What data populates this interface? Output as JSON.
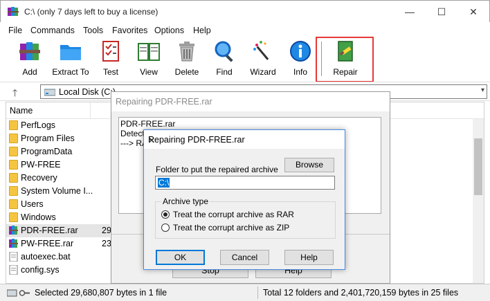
{
  "window": {
    "title": "C:\\ (only 7 days left to buy a license)",
    "minimize": "—",
    "maximize": "☐",
    "close": "✕"
  },
  "menu": [
    "File",
    "Commands",
    "Tools",
    "Favorites",
    "Options",
    "Help"
  ],
  "toolbar": {
    "buttons": [
      {
        "label": "Add",
        "icon": "archive-books-icon"
      },
      {
        "label": "Extract To",
        "icon": "folder-icon"
      },
      {
        "label": "Test",
        "icon": "checklist-icon"
      },
      {
        "label": "View",
        "icon": "open-book-icon"
      },
      {
        "label": "Delete",
        "icon": "trash-icon"
      },
      {
        "label": "Find",
        "icon": "magnifier-icon"
      },
      {
        "label": "Wizard",
        "icon": "wand-icon"
      },
      {
        "label": "Info",
        "icon": "info-icon"
      },
      {
        "label": "Repair",
        "icon": "repair-kit-icon"
      }
    ]
  },
  "address": {
    "up": "🡑",
    "value": "Local Disk (C:)",
    "dropdown": "▾"
  },
  "filelist": {
    "column_name": "Name",
    "rows": [
      {
        "name": "PerfLogs",
        "size": "",
        "type": "folder"
      },
      {
        "name": "Program Files",
        "size": "",
        "type": "folder"
      },
      {
        "name": "ProgramData",
        "size": "",
        "type": "folder"
      },
      {
        "name": "PW-FREE",
        "size": "",
        "type": "folder"
      },
      {
        "name": "Recovery",
        "size": "",
        "type": "folder"
      },
      {
        "name": "System Volume I...",
        "size": "",
        "type": "folder"
      },
      {
        "name": "Users",
        "size": "",
        "type": "folder"
      },
      {
        "name": "Windows",
        "size": "",
        "type": "folder"
      },
      {
        "name": "PDR-FREE.rar",
        "size": "29",
        "type": "rar",
        "selected": true
      },
      {
        "name": "PW-FREE.rar",
        "size": "23",
        "type": "rar"
      },
      {
        "name": "autoexec.bat",
        "size": "",
        "type": "file"
      },
      {
        "name": "config.sys",
        "size": "",
        "type": "file"
      }
    ]
  },
  "status": {
    "left": "Selected 29,680,807 bytes in 1 file",
    "right": "Total 12 folders and 2,401,720,159 bytes in 25 files"
  },
  "repair_window": {
    "title": "Repairing PDR-FREE.rar",
    "log": [
      "PDR-FREE.rar",
      "Detecting archive type",
      "---> RAR"
    ],
    "stop": "Stop",
    "help": "Help"
  },
  "dialog": {
    "title": "Repairing PDR-FREE.rar",
    "close": "✕",
    "folder_label": "Folder to put the repaired archive",
    "browse": "Browse",
    "path_value": "C:\\",
    "group_label": "Archive type",
    "options": [
      {
        "label": "Treat the corrupt archive as RAR",
        "checked": true
      },
      {
        "label": "Treat the corrupt archive as ZIP",
        "checked": false
      }
    ],
    "ok": "OK",
    "cancel": "Cancel",
    "help": "Help"
  },
  "colors": {
    "highlight_border": "#e53935",
    "selection": "#0078d7",
    "folder": "#f5c542"
  }
}
